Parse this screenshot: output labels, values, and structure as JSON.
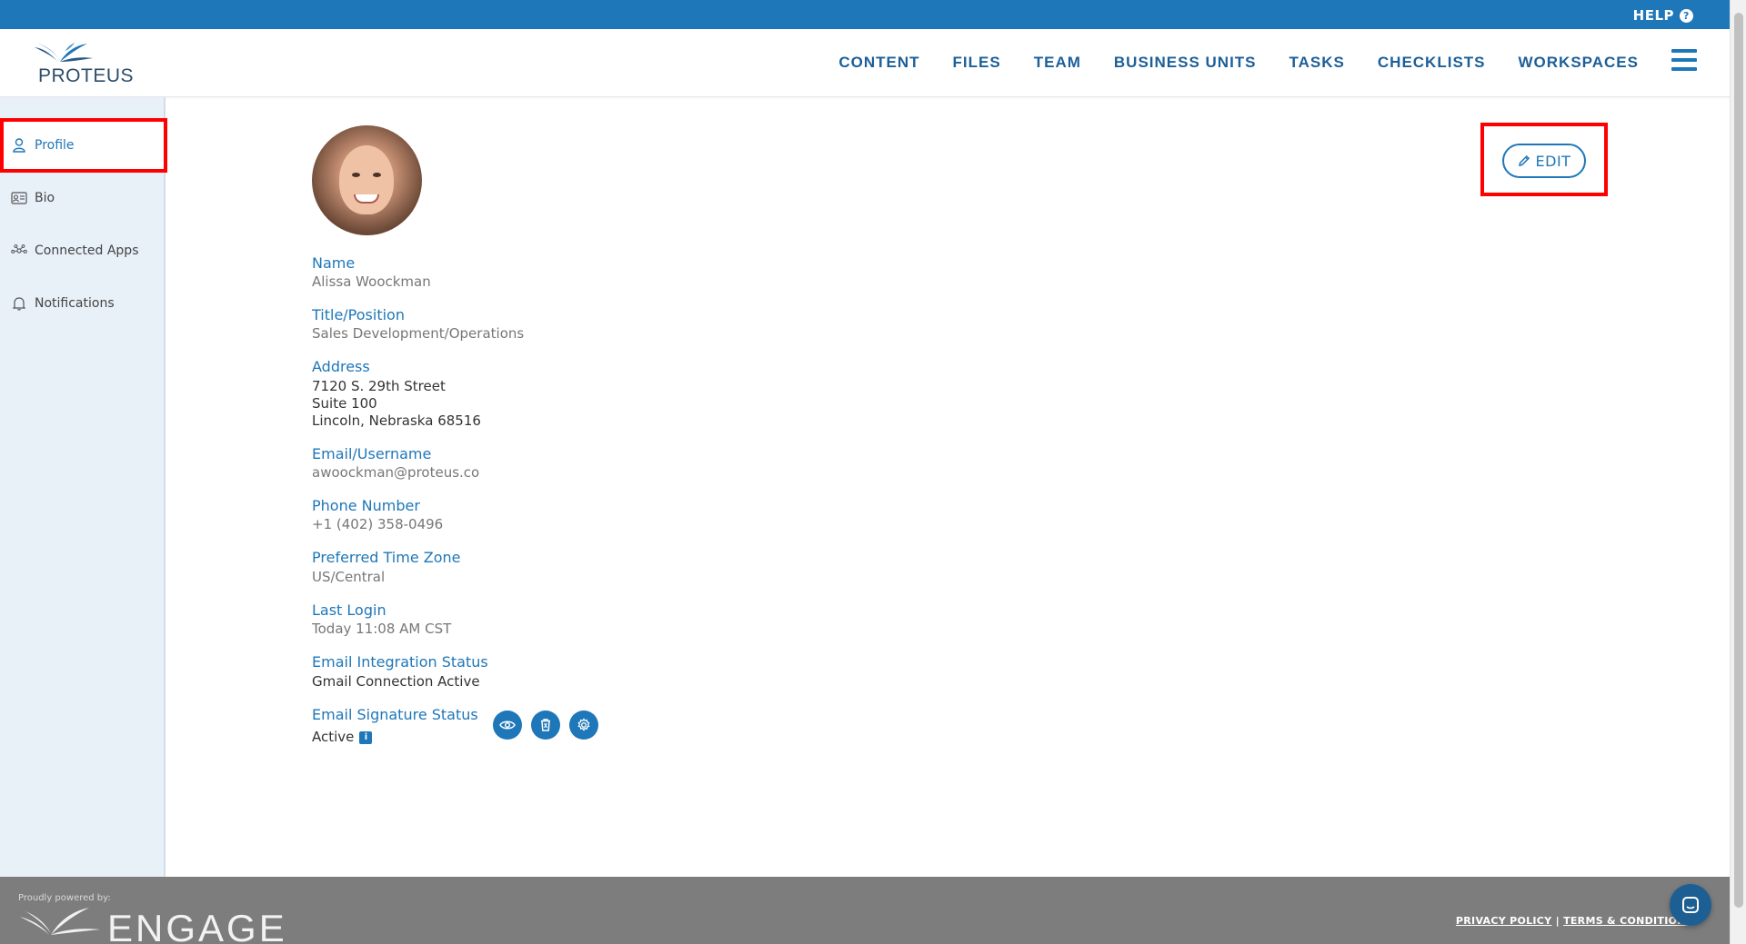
{
  "topbar": {
    "help_label": "HELP",
    "help_icon": "question-circle-icon"
  },
  "header": {
    "logo_text": "PROTEUS",
    "nav": [
      "CONTENT",
      "FILES",
      "TEAM",
      "BUSINESS UNITS",
      "TASKS",
      "CHECKLISTS",
      "WORKSPACES"
    ]
  },
  "sidebar": {
    "items": [
      {
        "label": "Profile",
        "icon": "user-icon",
        "active": true
      },
      {
        "label": "Bio",
        "icon": "id-card-icon",
        "active": false
      },
      {
        "label": "Connected Apps",
        "icon": "network-icon",
        "active": false
      },
      {
        "label": "Notifications",
        "icon": "bell-icon",
        "active": false
      }
    ]
  },
  "profile": {
    "edit_label": "EDIT",
    "fields": {
      "name": {
        "label": "Name",
        "value": "Alissa Woockman"
      },
      "title": {
        "label": "Title/Position",
        "value": "Sales Development/Operations"
      },
      "address": {
        "label": "Address",
        "line1": "7120 S. 29th Street",
        "line2": "Suite 100",
        "line3": "Lincoln, Nebraska 68516"
      },
      "email": {
        "label": "Email/Username",
        "value": "awoockman@proteus.co"
      },
      "phone": {
        "label": "Phone Number",
        "value": "+1 (402) 358-0496"
      },
      "timezone": {
        "label": "Preferred Time Zone",
        "value": "US/Central"
      },
      "last_login": {
        "label": "Last Login",
        "value": "Today 11:08 AM CST"
      },
      "email_integration": {
        "label": "Email Integration Status",
        "value": "Gmail Connection Active"
      },
      "email_signature": {
        "label": "Email Signature Status",
        "value": "Active"
      }
    }
  },
  "footer": {
    "powered_by": "Proudly powered by:",
    "brand": "ENGAGE",
    "privacy": "PRIVACY POLICY",
    "separator": "|",
    "terms": "TERMS & CONDITIONS"
  },
  "colors": {
    "accent": "#1e77b8",
    "highlight": "#ff0000",
    "footer": "#7d7d7d",
    "sidebar": "#e8f0f8"
  }
}
